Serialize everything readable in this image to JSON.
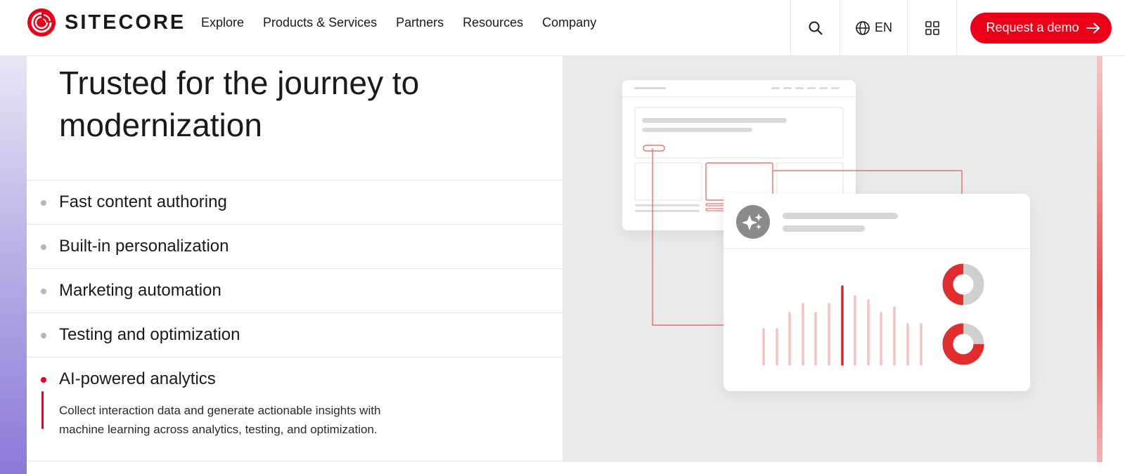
{
  "brand": {
    "name": "SITECORE",
    "accent": "#eb001a",
    "rail_gradient": [
      "#e9e6f6",
      "#8c79d8"
    ]
  },
  "nav": [
    {
      "label": "Explore"
    },
    {
      "label": "Products & Services"
    },
    {
      "label": "Partners"
    },
    {
      "label": "Resources"
    },
    {
      "label": "Company"
    }
  ],
  "header_tools": {
    "search_icon": "search-icon",
    "language_icon": "globe-icon",
    "language": "EN",
    "apps_icon": "grid-icon",
    "cta_label": "Request a demo",
    "cta_icon": "arrow-right-icon"
  },
  "main": {
    "heading": "Trusted for the journey to modernization",
    "features": [
      {
        "label": "Fast content authoring",
        "active": false
      },
      {
        "label": "Built-in personalization",
        "active": false
      },
      {
        "label": "Marketing automation",
        "active": false
      },
      {
        "label": "Testing and optimization",
        "active": false
      },
      {
        "label": "AI-powered analytics",
        "active": true,
        "description": "Collect interaction data and generate actionable insights with machine learning across analytics, testing, and optimization."
      }
    ]
  },
  "illustration": {
    "icon": "sparkle-icon",
    "donuts": [
      {
        "filled": 0.5
      },
      {
        "filled": 0.75
      }
    ]
  }
}
